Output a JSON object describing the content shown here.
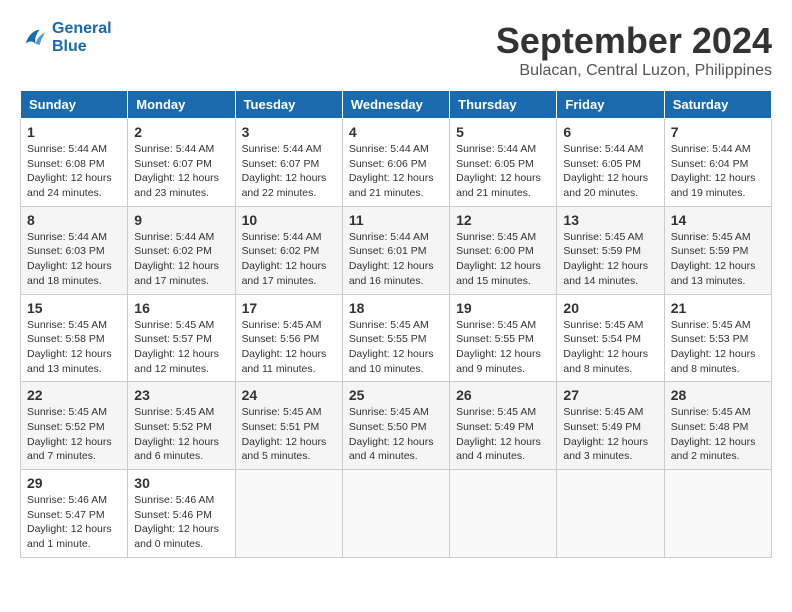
{
  "header": {
    "logo_line1": "General",
    "logo_line2": "Blue",
    "month": "September 2024",
    "location": "Bulacan, Central Luzon, Philippines"
  },
  "weekdays": [
    "Sunday",
    "Monday",
    "Tuesday",
    "Wednesday",
    "Thursday",
    "Friday",
    "Saturday"
  ],
  "weeks": [
    [
      {
        "day": "1",
        "sunrise": "5:44 AM",
        "sunset": "6:08 PM",
        "daylight": "12 hours and 24 minutes."
      },
      {
        "day": "2",
        "sunrise": "5:44 AM",
        "sunset": "6:07 PM",
        "daylight": "12 hours and 23 minutes."
      },
      {
        "day": "3",
        "sunrise": "5:44 AM",
        "sunset": "6:07 PM",
        "daylight": "12 hours and 22 minutes."
      },
      {
        "day": "4",
        "sunrise": "5:44 AM",
        "sunset": "6:06 PM",
        "daylight": "12 hours and 21 minutes."
      },
      {
        "day": "5",
        "sunrise": "5:44 AM",
        "sunset": "6:05 PM",
        "daylight": "12 hours and 21 minutes."
      },
      {
        "day": "6",
        "sunrise": "5:44 AM",
        "sunset": "6:05 PM",
        "daylight": "12 hours and 20 minutes."
      },
      {
        "day": "7",
        "sunrise": "5:44 AM",
        "sunset": "6:04 PM",
        "daylight": "12 hours and 19 minutes."
      }
    ],
    [
      {
        "day": "8",
        "sunrise": "5:44 AM",
        "sunset": "6:03 PM",
        "daylight": "12 hours and 18 minutes."
      },
      {
        "day": "9",
        "sunrise": "5:44 AM",
        "sunset": "6:02 PM",
        "daylight": "12 hours and 17 minutes."
      },
      {
        "day": "10",
        "sunrise": "5:44 AM",
        "sunset": "6:02 PM",
        "daylight": "12 hours and 17 minutes."
      },
      {
        "day": "11",
        "sunrise": "5:44 AM",
        "sunset": "6:01 PM",
        "daylight": "12 hours and 16 minutes."
      },
      {
        "day": "12",
        "sunrise": "5:45 AM",
        "sunset": "6:00 PM",
        "daylight": "12 hours and 15 minutes."
      },
      {
        "day": "13",
        "sunrise": "5:45 AM",
        "sunset": "5:59 PM",
        "daylight": "12 hours and 14 minutes."
      },
      {
        "day": "14",
        "sunrise": "5:45 AM",
        "sunset": "5:59 PM",
        "daylight": "12 hours and 13 minutes."
      }
    ],
    [
      {
        "day": "15",
        "sunrise": "5:45 AM",
        "sunset": "5:58 PM",
        "daylight": "12 hours and 13 minutes."
      },
      {
        "day": "16",
        "sunrise": "5:45 AM",
        "sunset": "5:57 PM",
        "daylight": "12 hours and 12 minutes."
      },
      {
        "day": "17",
        "sunrise": "5:45 AM",
        "sunset": "5:56 PM",
        "daylight": "12 hours and 11 minutes."
      },
      {
        "day": "18",
        "sunrise": "5:45 AM",
        "sunset": "5:55 PM",
        "daylight": "12 hours and 10 minutes."
      },
      {
        "day": "19",
        "sunrise": "5:45 AM",
        "sunset": "5:55 PM",
        "daylight": "12 hours and 9 minutes."
      },
      {
        "day": "20",
        "sunrise": "5:45 AM",
        "sunset": "5:54 PM",
        "daylight": "12 hours and 8 minutes."
      },
      {
        "day": "21",
        "sunrise": "5:45 AM",
        "sunset": "5:53 PM",
        "daylight": "12 hours and 8 minutes."
      }
    ],
    [
      {
        "day": "22",
        "sunrise": "5:45 AM",
        "sunset": "5:52 PM",
        "daylight": "12 hours and 7 minutes."
      },
      {
        "day": "23",
        "sunrise": "5:45 AM",
        "sunset": "5:52 PM",
        "daylight": "12 hours and 6 minutes."
      },
      {
        "day": "24",
        "sunrise": "5:45 AM",
        "sunset": "5:51 PM",
        "daylight": "12 hours and 5 minutes."
      },
      {
        "day": "25",
        "sunrise": "5:45 AM",
        "sunset": "5:50 PM",
        "daylight": "12 hours and 4 minutes."
      },
      {
        "day": "26",
        "sunrise": "5:45 AM",
        "sunset": "5:49 PM",
        "daylight": "12 hours and 4 minutes."
      },
      {
        "day": "27",
        "sunrise": "5:45 AM",
        "sunset": "5:49 PM",
        "daylight": "12 hours and 3 minutes."
      },
      {
        "day": "28",
        "sunrise": "5:45 AM",
        "sunset": "5:48 PM",
        "daylight": "12 hours and 2 minutes."
      }
    ],
    [
      {
        "day": "29",
        "sunrise": "5:46 AM",
        "sunset": "5:47 PM",
        "daylight": "12 hours and 1 minute."
      },
      {
        "day": "30",
        "sunrise": "5:46 AM",
        "sunset": "5:46 PM",
        "daylight": "12 hours and 0 minutes."
      },
      null,
      null,
      null,
      null,
      null
    ]
  ]
}
